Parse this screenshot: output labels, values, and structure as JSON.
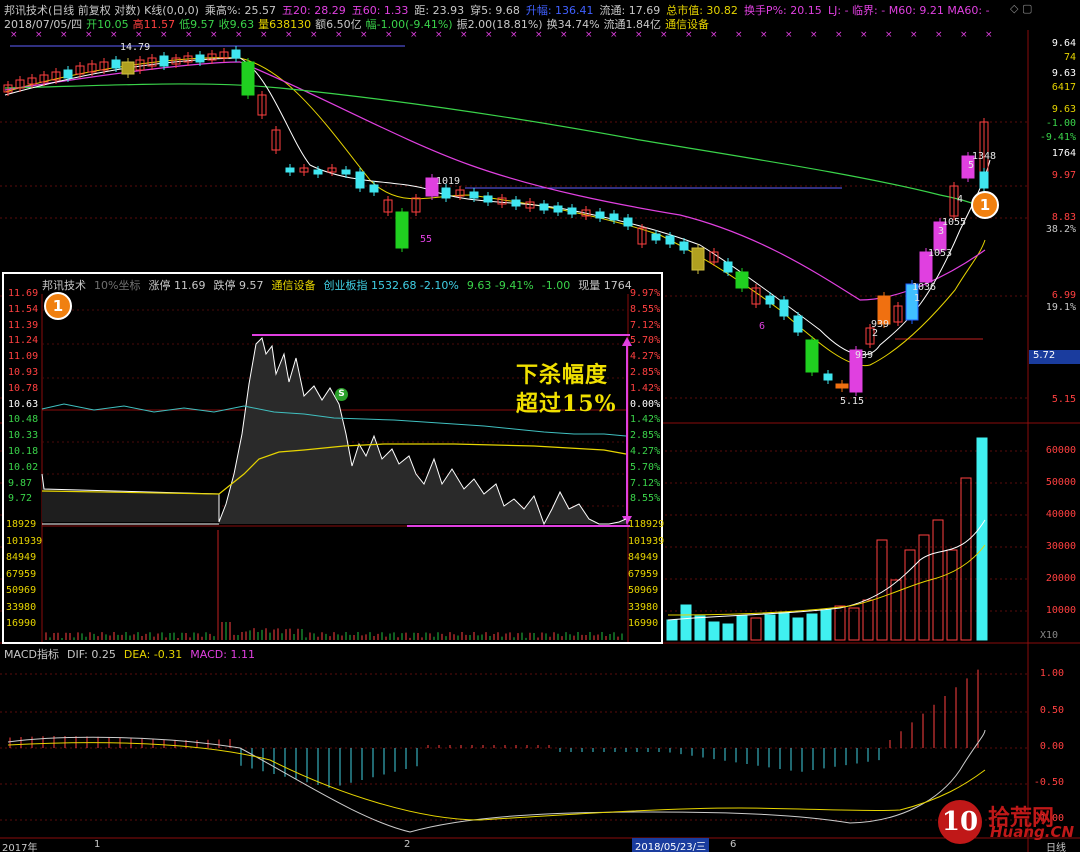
{
  "header": {
    "line1": [
      {
        "text": "邦讯技术(日线 前复权 对数) K线(0,0,0)",
        "color": "#c8c8c8"
      },
      {
        "text": "乘高%: 25.57",
        "color": "#c8c8c8"
      },
      {
        "text": "五20: 28.29",
        "color": "#e040e0"
      },
      {
        "text": "五60: 1.33",
        "color": "#e040e0"
      },
      {
        "text": "距: 23.93",
        "color": "#c8c8c8"
      },
      {
        "text": "穿5: 9.68",
        "color": "#c8c8c8"
      },
      {
        "text": "升幅: 136.41",
        "color": "#4060ff"
      },
      {
        "text": "流通: 17.69",
        "color": "#c8c8c8"
      },
      {
        "text": "总市值: 30.82",
        "color": "#e6d400"
      },
      {
        "text": "换手P%: 20.15",
        "color": "#e040e0"
      }
    ],
    "line1_right": "LJ: -  临界: -  M60: 9.21  MA60: -",
    "line2": [
      {
        "text": "2018/07/05/四",
        "color": "#c8c8c8"
      },
      {
        "text": "开10.05",
        "color": "#3ad34a"
      },
      {
        "text": "高11.57",
        "color": "#ff4040"
      },
      {
        "text": "低9.57",
        "color": "#3ad34a"
      },
      {
        "text": "收9.63",
        "color": "#3ad34a"
      },
      {
        "text": "量638130",
        "color": "#e6d400"
      },
      {
        "text": "额6.50亿",
        "color": "#c8c8c8"
      },
      {
        "text": "幅-1.00(-9.41%)",
        "color": "#3ad34a"
      },
      {
        "text": "振2.00(18.81%)",
        "color": "#c8c8c8"
      },
      {
        "text": "换34.74%",
        "color": "#c8c8c8"
      },
      {
        "text": "流通1.84亿",
        "color": "#c8c8c8"
      },
      {
        "text": "通信设备",
        "color": "#e6d400"
      }
    ]
  },
  "price_axis": [
    {
      "text": "9.64",
      "color": "#ffffff"
    },
    {
      "text": "74",
      "color": "#e6d400"
    },
    {
      "text": "9.63",
      "color": "#ffffff"
    },
    {
      "text": "6417",
      "color": "#e6d400"
    },
    {
      "text": "9.63",
      "color": "#e6d400"
    },
    {
      "text": "-1.00",
      "color": "#3ad34a"
    },
    {
      "text": "-9.41%",
      "color": "#3ad34a"
    },
    {
      "text": "1764",
      "color": "#ffffff"
    },
    {
      "text": "9.97",
      "color": "#ff4040"
    },
    {
      "text": "8.83",
      "color": "#ff4040"
    },
    {
      "text": "38.2%",
      "color": "#c8c8c8"
    },
    {
      "text": "6.99",
      "color": "#ff4040"
    },
    {
      "text": "19.1%",
      "color": "#c8c8c8"
    },
    {
      "text": "5.72",
      "color": "#ffffff"
    },
    {
      "text": "5.15",
      "color": "#ff4040"
    }
  ],
  "vol_axis": [
    "60000",
    "50000",
    "40000",
    "30000",
    "20000",
    "10000",
    "X10"
  ],
  "macd_axis": [
    "1.00",
    "0.50",
    "0.00",
    "-0.50",
    "-1.00"
  ],
  "macd_header": [
    {
      "text": "MACD指标",
      "color": "#c8c8c8"
    },
    {
      "text": "DIF: 0.25",
      "color": "#c8c8c8"
    },
    {
      "text": "DEA: -0.31",
      "color": "#e6d400"
    },
    {
      "text": "MACD: 1.11",
      "color": "#e040e0"
    }
  ],
  "chart_labels": {
    "high": "14.79",
    "low": "5.15",
    "n55": "55",
    "n6": "6",
    "n1019": "1019",
    "n939a": "939",
    "n939b": "939",
    "n1036": "1036",
    "n1053": "1053",
    "n1055": "1055",
    "n1348": "1348",
    "n4": "4",
    "n2": "2",
    "n1": "1",
    "n3": "3",
    "n5": "5"
  },
  "timeline": {
    "year": "2017年",
    "t1": "1",
    "t2": "2",
    "date": "2018/05/23/三",
    "t6": "6",
    "right": "日线"
  },
  "badge": "1",
  "inset": {
    "header": [
      {
        "text": "邦讯技术",
        "color": "#c8c8c8"
      },
      {
        "text": "10%坐标",
        "color": "#707070"
      },
      {
        "text": "涨停 11.69",
        "color": "#c8c8c8"
      },
      {
        "text": "跌停 9.57",
        "color": "#c8c8c8"
      },
      {
        "text": "通信设备",
        "color": "#e6d400"
      },
      {
        "text": "创业板指 1532.68 -2.10%",
        "color": "#40d0e6"
      },
      {
        "text": "9.63 -9.41%",
        "color": "#3ad34a"
      },
      {
        "text": "-1.00",
        "color": "#3ad34a"
      },
      {
        "text": "现量 1764",
        "color": "#c8c8c8"
      }
    ],
    "left_prices": [
      "11.69",
      "11.54",
      "11.39",
      "11.24",
      "11.09",
      "10.93",
      "10.78",
      "10.63",
      "10.48",
      "10.33",
      "10.18",
      "10.02",
      "9.87",
      "9.72"
    ],
    "right_pcts": [
      "9.97%",
      "8.55%",
      "7.12%",
      "5.70%",
      "4.27%",
      "2.85%",
      "1.42%",
      "0.00%",
      "1.42%",
      "2.85%",
      "4.27%",
      "5.70%",
      "7.12%",
      "8.55%"
    ],
    "left_vol": [
      "18929",
      "101939",
      "84949",
      "67959",
      "50969",
      "33980",
      "16990"
    ],
    "right_vol": [
      "118929",
      "101939",
      "84949",
      "67959",
      "50969",
      "33980",
      "16990"
    ],
    "annotation": [
      "下杀幅度",
      "超过15%"
    ],
    "s_marker": "S",
    "badge": "1"
  },
  "watermark": {
    "logo": "10",
    "text1": "拾荒网",
    "text2": "Huang.CN"
  }
}
